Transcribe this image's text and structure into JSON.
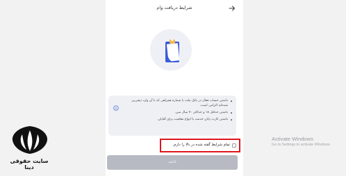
{
  "header": {
    "title": "شرایط دریافت وام",
    "back_icon": "arrow-right-icon"
  },
  "illustration": {
    "icon": "clipboard-icon"
  },
  "conditions": {
    "info_icon": "info-icon",
    "items": [
      "داشتن حساب فعال در بانک ملت با شماره همراهی که با آن وارد دیجی‌پی شده‌اید الزامی است.",
      "داشتن حداقل ۱۸ و حداکثر ۷۰ سال سن.",
      "داشتن کارت پایان خدمت یا انواع معافیت برای آقایان."
    ]
  },
  "agreement": {
    "label": "تمام شرایط گفته شده در بالا را دارم."
  },
  "continue_button": {
    "label": "ادامه"
  },
  "watermark": {
    "site_name": "سایت حقوقی دینا",
    "activate_title": "Activate Windows",
    "activate_subtitle": "Go to Settings to activate Windows."
  },
  "colors": {
    "highlight_border": "#e0141c",
    "button_disabled": "#b7bac2",
    "card_background": "#eef0f4",
    "accent_blue": "#3a5bd9"
  }
}
